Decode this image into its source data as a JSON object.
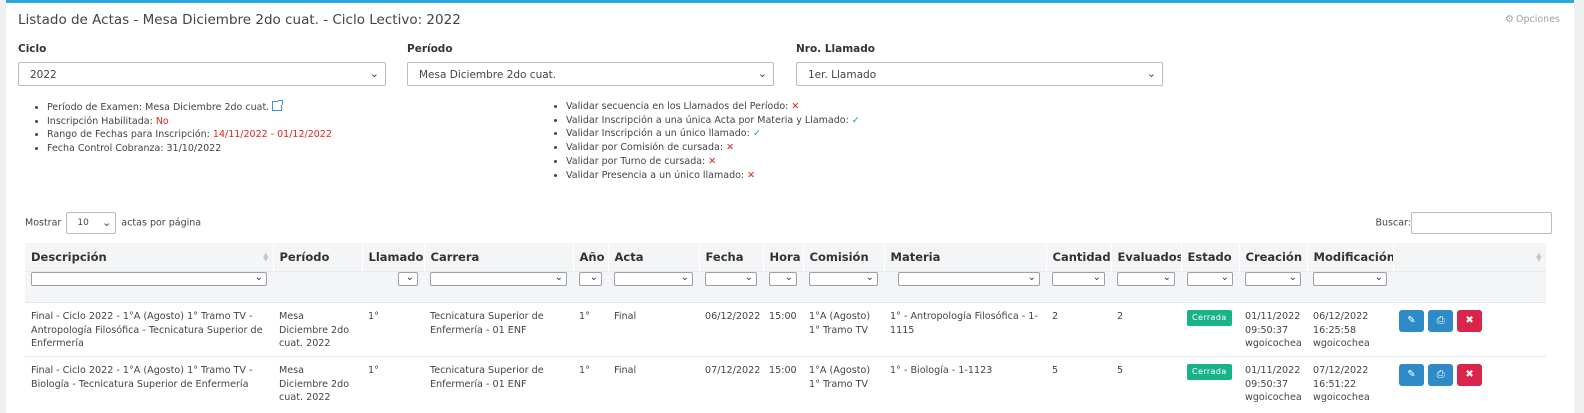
{
  "header": {
    "title": "Listado de Actas - Mesa Diciembre 2do cuat. - Ciclo Lectivo: 2022",
    "options_label": "Opciones"
  },
  "filters": {
    "ciclo": {
      "label": "Ciclo",
      "value": "2022"
    },
    "periodo": {
      "label": "Período",
      "value": "Mesa Diciembre 2do cuat."
    },
    "llamado": {
      "label": "Nro. Llamado",
      "value": "1er. Llamado"
    }
  },
  "info_left": {
    "periodo_examen": {
      "label": "Período de Examen: ",
      "value": "Mesa Diciembre 2do cuat."
    },
    "inscripcion": {
      "label": "Inscripción Habilitada: ",
      "value": "No"
    },
    "rango": {
      "label": "Rango de Fechas para Inscripción: ",
      "value": "14/11/2022 - 01/12/2022"
    },
    "cobranza": {
      "label": "Fecha Control Cobranza: ",
      "value": "31/10/2022"
    }
  },
  "info_right": [
    {
      "label": "Validar secuencia en los Llamados del Período: ",
      "mark": "✕",
      "ok": false
    },
    {
      "label": "Validar Inscripción a una única Acta por Materia y Llamado: ",
      "mark": "✓",
      "ok": true
    },
    {
      "label": "Validar Inscripción a un único llamado: ",
      "mark": "✓",
      "ok": true
    },
    {
      "label": "Validar por Comisión de cursada: ",
      "mark": "✕",
      "ok": false
    },
    {
      "label": "Validar por Turno de cursada: ",
      "mark": "✕",
      "ok": false
    },
    {
      "label": "Validar Presencia a un único llamado: ",
      "mark": "✕",
      "ok": false
    }
  ],
  "table_controls": {
    "show_prefix": "Mostrar",
    "page_size": "10",
    "show_suffix": "actas por página",
    "search_label": "Buscar:"
  },
  "table": {
    "columns": [
      "Descripción",
      "Período",
      "Llamado",
      "Carrera",
      "Año",
      "Acta",
      "Fecha",
      "Hora",
      "Comisión",
      "Materia",
      "Cantidad",
      "Evaluados",
      "Estado",
      "Creación",
      "Modificación",
      ""
    ],
    "rows": [
      {
        "descripcion": "Final - Ciclo 2022 - 1°A (Agosto) 1° Tramo TV - Antropología Filosófica - Tecnicatura Superior de Enfermería",
        "periodo": "Mesa Diciembre 2do cuat. 2022",
        "llamado": "1°",
        "carrera": "Tecnicatura Superior de Enfermería - 01 ENF",
        "anio": "1°",
        "acta": "Final",
        "fecha": "06/12/2022",
        "hora": "15:00",
        "comision": "1°A (Agosto) 1° Tramo TV",
        "materia": "1° - Antropología Filosófica - 1-1115",
        "cantidad": "2",
        "evaluados": "2",
        "estado": "Cerrada",
        "creacion": [
          "01/11/2022",
          "09:50:37",
          "wgoicochea"
        ],
        "modificacion": [
          "06/12/2022",
          "16:25:58",
          "wgoicochea"
        ]
      },
      {
        "descripcion": "Final - Ciclo 2022 - 1°A (Agosto) 1° Tramo TV - Biología - Tecnicatura Superior de Enfermería",
        "periodo": "Mesa Diciembre 2do cuat. 2022",
        "llamado": "1°",
        "carrera": "Tecnicatura Superior de Enfermería - 01 ENF",
        "anio": "1°",
        "acta": "Final",
        "fecha": "07/12/2022",
        "hora": "15:00",
        "comision": "1°A (Agosto) 1° Tramo TV",
        "materia": "1° - Biología - 1-1123",
        "cantidad": "5",
        "evaluados": "5",
        "estado": "Cerrada",
        "creacion": [
          "01/11/2022",
          "09:50:37",
          "wgoicochea"
        ],
        "modificacion": [
          "07/12/2022 16:51:22",
          "wgoicochea"
        ]
      }
    ]
  },
  "icons": {
    "options": "gear-icon",
    "external": "external-link-icon",
    "edit": "edit-icon",
    "print": "print-icon",
    "delete": "trash-icon"
  },
  "colors": {
    "accent": "#2aa9e0",
    "danger_text": "#e0241c",
    "ok_check": "#22a049",
    "badge_closed": "#19b38a",
    "btn_primary": "#2e8bc7",
    "btn_danger": "#d9254a"
  }
}
